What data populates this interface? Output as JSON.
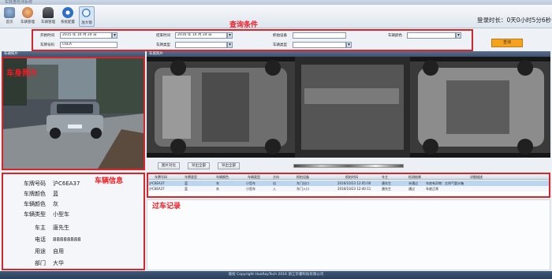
{
  "window": {
    "title": "车底盘检测系统"
  },
  "toolbar": {
    "items": [
      {
        "label": "首页",
        "icon": "home-icon"
      },
      {
        "label": "车辆管理",
        "icon": "car-manage-icon"
      },
      {
        "label": "车辆管理",
        "icon": "vehicle-icon"
      },
      {
        "label": "系统配置",
        "icon": "gear-icon"
      },
      {
        "label": "放大镜",
        "icon": "magnifier-icon"
      }
    ]
  },
  "login_time": "登录时长：0天0小时5分6秒",
  "annotations": {
    "query": "查询条件",
    "car_photo": "车身照片",
    "vehicle_info": "车辆信息",
    "pass_records": "过车记录"
  },
  "query": {
    "start_label": "开始时间",
    "start_value": "2015 年 10 月 24 日",
    "end_label": "结束时间",
    "end_value": "2016 年 10 月 24 日",
    "device_label": "抓拍设备",
    "color_label": "车辆颜色",
    "plate_label": "车牌号码",
    "plate_value": "C6EA",
    "plate_type_label": "车牌类型",
    "car_type_label": "车辆类型",
    "search_button": "查询"
  },
  "panels": {
    "car_photo_title": "车辆照片",
    "under_photo_title": "车底照片"
  },
  "photo_buttons": [
    "图片对比",
    "导出全部",
    "导出全部"
  ],
  "vehicle_info": [
    {
      "key": "车牌号码",
      "value": "沪C6EA37"
    },
    {
      "key": "车牌颜色",
      "value": "蓝"
    },
    {
      "key": "车辆颜色",
      "value": "灰"
    },
    {
      "key": "车辆类型",
      "value": "小型车"
    },
    {
      "key": "车主",
      "value": "唐先生"
    },
    {
      "key": "电话",
      "value": "88888888"
    },
    {
      "key": "用途",
      "value": "自用"
    },
    {
      "key": "部门",
      "value": "大华"
    }
  ],
  "records": {
    "columns": [
      "车牌号码",
      "车牌类型",
      "车辆颜色",
      "车辆类型",
      "方向",
      "抓拍设备",
      "抓拍时间",
      "车主",
      "检测结果",
      "详细描述"
    ],
    "rows": [
      [
        "沪C6EA37",
        "蓝",
        "灰",
        "小型车",
        "出",
        "东门出口",
        "2016/10/23 12:05:00",
        "唐先生",
        "未通过",
        "车底有异物：左排气管水箱"
      ],
      [
        "沪C6EA37",
        "蓝",
        "灰",
        "小型车",
        "入",
        "东门入口",
        "2016/10/23 12:40:11",
        "唐先生",
        "通过",
        "车底正常"
      ]
    ]
  },
  "status_bar": "版权 Copyright  HuaRayTech 2016 浙江华睿科技有限公司",
  "colors": {
    "accent_red": "#d8252a",
    "search_orange": "#f5a21c",
    "header_dark": "#3d516e"
  }
}
